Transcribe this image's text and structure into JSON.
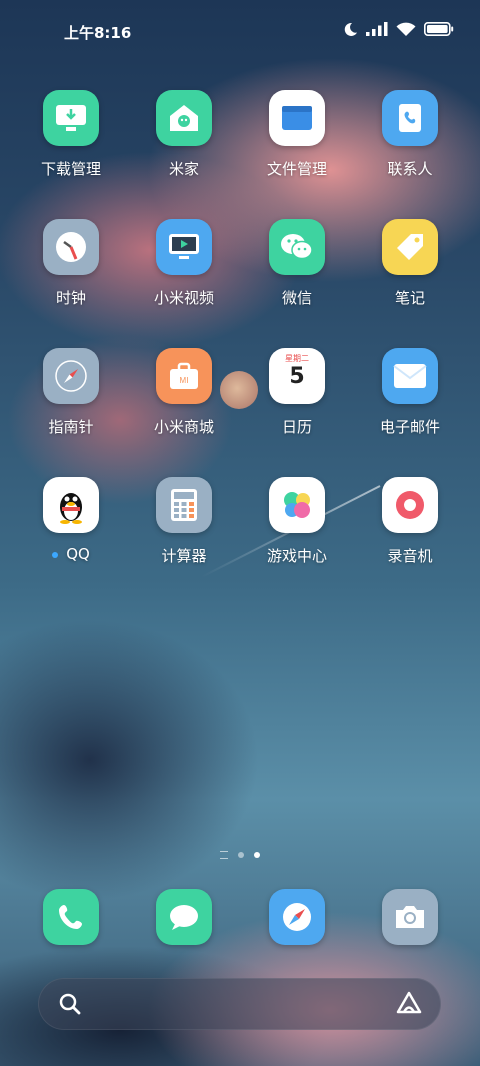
{
  "status_bar": {
    "time": "上午8:16",
    "icons": [
      "moon-icon",
      "signal-icon",
      "wifi-icon",
      "battery-icon"
    ]
  },
  "apps": [
    {
      "label": "下载管理",
      "icon": "download-monitor-icon",
      "color": "#3ed3a0"
    },
    {
      "label": "米家",
      "icon": "mijia-home-icon",
      "color": "#3ed3a0"
    },
    {
      "label": "文件管理",
      "icon": "folder-icon",
      "color": "#ffffff"
    },
    {
      "label": "联系人",
      "icon": "contacts-icon",
      "color": "#4ea8f0"
    },
    {
      "label": "时钟",
      "icon": "clock-icon",
      "color": "#9ab0c4"
    },
    {
      "label": "小米视频",
      "icon": "video-icon",
      "color": "#4ea8f0"
    },
    {
      "label": "微信",
      "icon": "wechat-icon",
      "color": "#3ed3a0"
    },
    {
      "label": "笔记",
      "icon": "notes-tag-icon",
      "color": "#f7d654"
    },
    {
      "label": "指南针",
      "icon": "compass-icon",
      "color": "#9ab0c4"
    },
    {
      "label": "小米商城",
      "icon": "mi-store-bag-icon",
      "color": "#f7935a"
    },
    {
      "label": "日历",
      "icon": "calendar-icon",
      "color": "#ffffff",
      "cal_weekday": "星期二",
      "cal_day": "5"
    },
    {
      "label": "电子邮件",
      "icon": "mail-icon",
      "color": "#4ea8f0"
    },
    {
      "label": "QQ",
      "icon": "qq-penguin-icon",
      "color": "#ffffff",
      "badge": "new"
    },
    {
      "label": "计算器",
      "icon": "calculator-icon",
      "color": "#9ab0c4"
    },
    {
      "label": "游戏中心",
      "icon": "game-center-icon",
      "color": "#ffffff"
    },
    {
      "label": "录音机",
      "icon": "recorder-icon",
      "color": "#ffffff"
    }
  ],
  "dock": [
    {
      "icon": "phone-icon",
      "color": "#3ed3a0"
    },
    {
      "icon": "messages-icon",
      "color": "#3ed3a0"
    },
    {
      "icon": "browser-compass-icon",
      "color": "#4ea8f0"
    },
    {
      "icon": "camera-icon",
      "color": "#9ab0c4"
    }
  ],
  "page_indicator": {
    "pages": 3,
    "current": 3
  },
  "search_bar": {
    "left_icon": "search-icon",
    "right_icon": "assistant-icon"
  }
}
